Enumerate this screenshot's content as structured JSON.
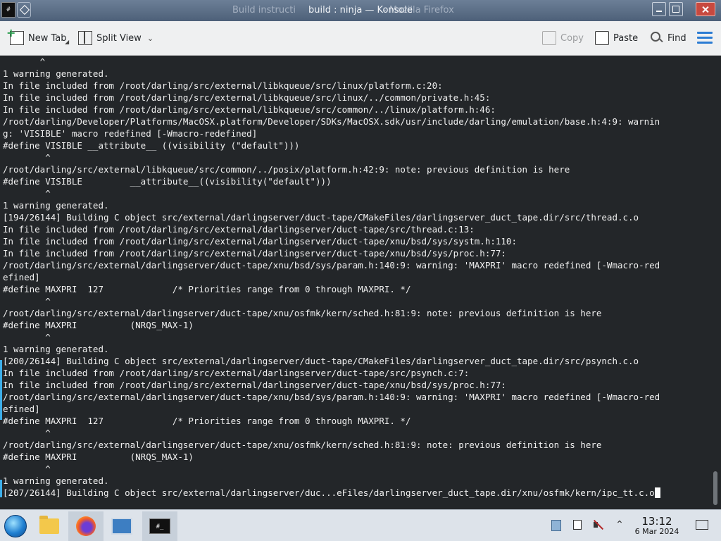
{
  "window": {
    "title": "build : ninja — Konsole",
    "ghost_left": "Build instructi",
    "ghost_right": "- Mozilla Firefox",
    "app_icon_text": "#"
  },
  "toolbar": {
    "new_tab": "New Tab",
    "split_view": "Split View",
    "copy": "Copy",
    "paste": "Paste",
    "find": "Find"
  },
  "terminal": {
    "lines": [
      "       ^",
      "1 warning generated.",
      "In file included from /root/darling/src/external/libkqueue/src/linux/platform.c:20:",
      "In file included from /root/darling/src/external/libkqueue/src/linux/../common/private.h:45:",
      "In file included from /root/darling/src/external/libkqueue/src/common/../linux/platform.h:46:",
      "/root/darling/Developer/Platforms/MacOSX.platform/Developer/SDKs/MacOSX.sdk/usr/include/darling/emulation/base.h:4:9: warnin",
      "g: 'VISIBLE' macro redefined [-Wmacro-redefined]",
      "#define VISIBLE __attribute__ ((visibility (\"default\")))",
      "        ^",
      "/root/darling/src/external/libkqueue/src/common/../posix/platform.h:42:9: note: previous definition is here",
      "#define VISIBLE         __attribute__((visibility(\"default\")))",
      "        ^",
      "1 warning generated.",
      "[194/26144] Building C object src/external/darlingserver/duct-tape/CMakeFiles/darlingserver_duct_tape.dir/src/thread.c.o",
      "In file included from /root/darling/src/external/darlingserver/duct-tape/src/thread.c:13:",
      "In file included from /root/darling/src/external/darlingserver/duct-tape/xnu/bsd/sys/systm.h:110:",
      "In file included from /root/darling/src/external/darlingserver/duct-tape/xnu/bsd/sys/proc.h:77:",
      "/root/darling/src/external/darlingserver/duct-tape/xnu/bsd/sys/param.h:140:9: warning: 'MAXPRI' macro redefined [-Wmacro-red",
      "efined]",
      "#define MAXPRI  127             /* Priorities range from 0 through MAXPRI. */",
      "        ^",
      "/root/darling/src/external/darlingserver/duct-tape/xnu/osfmk/kern/sched.h:81:9: note: previous definition is here",
      "#define MAXPRI          (NRQS_MAX-1)",
      "        ^",
      "1 warning generated.",
      "[200/26144] Building C object src/external/darlingserver/duct-tape/CMakeFiles/darlingserver_duct_tape.dir/src/psynch.c.o",
      "In file included from /root/darling/src/external/darlingserver/duct-tape/src/psynch.c:7:",
      "In file included from /root/darling/src/external/darlingserver/duct-tape/xnu/bsd/sys/proc.h:77:",
      "/root/darling/src/external/darlingserver/duct-tape/xnu/bsd/sys/param.h:140:9: warning: 'MAXPRI' macro redefined [-Wmacro-red",
      "efined]",
      "#define MAXPRI  127             /* Priorities range from 0 through MAXPRI. */",
      "        ^",
      "/root/darling/src/external/darlingserver/duct-tape/xnu/osfmk/kern/sched.h:81:9: note: previous definition is here",
      "#define MAXPRI          (NRQS_MAX-1)",
      "        ^",
      "1 warning generated.",
      "[207/26144] Building C object src/external/darlingserver/duc...eFiles/darlingserver_duct_tape.dir/xnu/osfmk/kern/ipc_tt.c.o"
    ]
  },
  "taskbar": {
    "konsole_icon_text": "#_",
    "clock_time": "13:12",
    "clock_date": "6 Mar 2024"
  },
  "icons": [
    "konsole-app-icon",
    "pin-icon",
    "minimize-icon",
    "maximize-icon",
    "close-icon",
    "new-tab-icon",
    "split-view-icon",
    "copy-icon",
    "paste-icon",
    "search-icon",
    "hamburger-menu-icon",
    "start-menu-icon",
    "file-manager-icon",
    "firefox-icon",
    "remote-desktop-icon",
    "konsole-icon",
    "vm-tray-icon",
    "clipboard-icon",
    "volume-muted-icon",
    "chevron-up-icon",
    "show-desktop-icon"
  ],
  "colors": {
    "terminal_bg": "#232629",
    "terminal_fg": "#f0f0f0",
    "accent": "#3daee9",
    "hamburger": "#2a7bd3",
    "close": "#c8493f"
  }
}
